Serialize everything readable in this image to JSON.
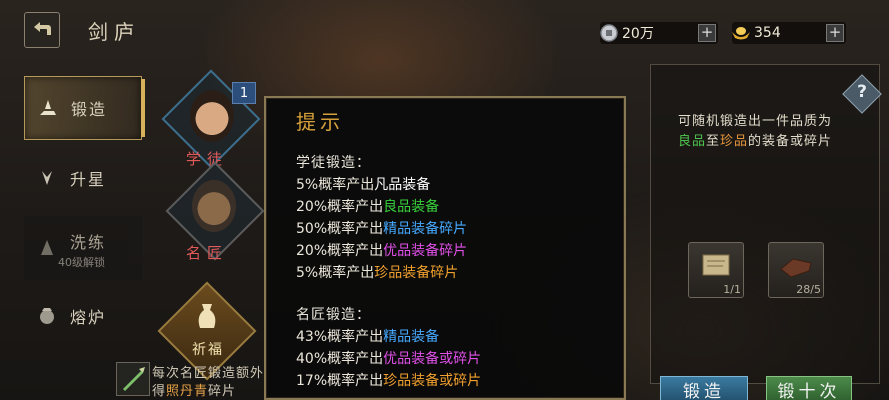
{
  "header": {
    "title": "剑庐"
  },
  "currency": {
    "silver": {
      "value": "20万",
      "icon": "silver-coin-icon"
    },
    "gold": {
      "value": "354",
      "icon": "gold-ingot-icon"
    },
    "plus_label": "+"
  },
  "menu": {
    "forge": "锻造",
    "star": "升星",
    "refine": "洗练",
    "refine_lock": "40级解锁",
    "furnace": "熔炉"
  },
  "characters": {
    "apprentice": "学徒",
    "master": "名匠",
    "apprentice_count": "1",
    "pray": "祈福"
  },
  "bottom_info": {
    "line1": "每次名匠锻造额外",
    "line2_prefix": "得",
    "line2_highlight": "照丹青",
    "line2_suffix": "碎片"
  },
  "right_panel": {
    "desc_line1": "可随机锻造出一件品质为",
    "desc_good": "良品",
    "desc_to": "至",
    "desc_rare": "珍品",
    "desc_tail": "的装备或碎片",
    "materials": [
      {
        "count": "1/1",
        "icon": "scroll-icon"
      },
      {
        "count": "28/5",
        "icon": "iron-ingot-icon"
      }
    ],
    "forge_button": "锻造",
    "forge10_button": "锻十次",
    "help": "?"
  },
  "popup": {
    "title": "提示",
    "apprentice_title": "学徒锻造：",
    "apprentice_lines": [
      {
        "prefix": "5%概率产出",
        "item": "凡品装备",
        "quality": "white"
      },
      {
        "prefix": "20%概率产出",
        "item": "良品装备",
        "quality": "green"
      },
      {
        "prefix": "50%概率产出",
        "item": "精品装备碎片",
        "quality": "blue"
      },
      {
        "prefix": "20%概率产出",
        "item": "优品装备碎片",
        "quality": "purple"
      },
      {
        "prefix": "5%概率产出",
        "item": "珍品装备碎片",
        "quality": "orange"
      }
    ],
    "master_title": "名匠锻造：",
    "master_lines": [
      {
        "prefix": "43%概率产出",
        "item": "精品装备",
        "quality": "blue"
      },
      {
        "prefix": "40%概率产出",
        "item": "优品装备或碎片",
        "quality": "purple"
      },
      {
        "prefix": "17%概率产出",
        "item": "珍品装备或碎片",
        "quality": "orange"
      }
    ]
  },
  "colors": {
    "white": "#ffffff",
    "green": "#38d23c",
    "blue": "#46a9ff",
    "purple": "#e050e8",
    "orange": "#f0a02e",
    "accent": "#d6a13a"
  }
}
